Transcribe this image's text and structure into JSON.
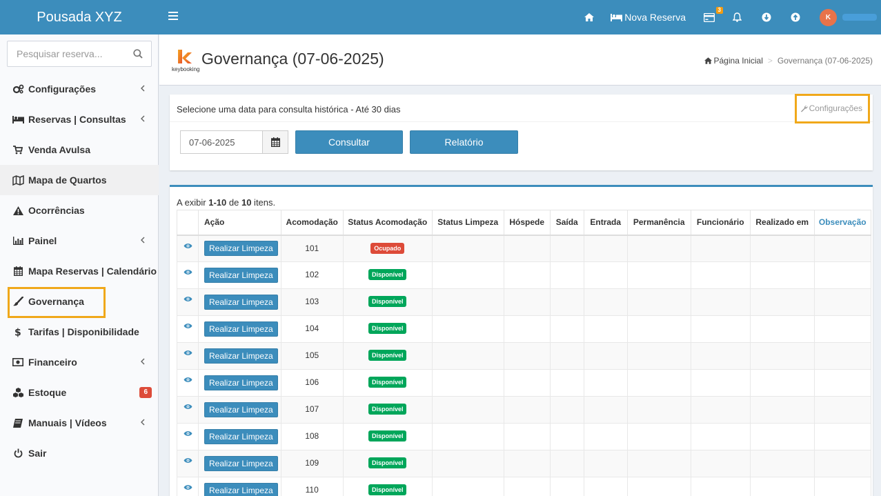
{
  "app": {
    "brand": "Pousada XYZ",
    "nova_reserva": "Nova Reserva",
    "notif_badge": "3",
    "avatar_initial": "K"
  },
  "sidebar": {
    "search_placeholder": "Pesquisar reserva...",
    "items": [
      {
        "label": "Configurações"
      },
      {
        "label": "Reservas | Consultas"
      },
      {
        "label": "Venda Avulsa"
      },
      {
        "label": "Mapa de Quartos"
      },
      {
        "label": "Ocorrências"
      },
      {
        "label": "Painel"
      },
      {
        "label": "Mapa Reservas | Calendário"
      },
      {
        "label": "Governança"
      },
      {
        "label": "Tarifas | Disponibilidade"
      },
      {
        "label": "Financeiro"
      },
      {
        "label": "Estoque",
        "badge": "6"
      },
      {
        "label": "Manuais | Vídeos"
      },
      {
        "label": "Sair"
      }
    ]
  },
  "header": {
    "logo_text": "keybooking",
    "title": "Governança (07-06-2025)",
    "breadcrumb_home": "Página Inicial",
    "breadcrumb_current": "Governança (07-06-2025)"
  },
  "filter": {
    "title": "Selecione uma data para consulta histórica - Até 30 dias",
    "config_link": "Configurações",
    "date_value": "07-06-2025",
    "consultar": "Consultar",
    "relatorio": "Relatório"
  },
  "table": {
    "summary_prefix": "A exibir ",
    "summary_range": "1-10",
    "summary_mid": " de ",
    "summary_total": "10",
    "summary_suffix": " itens.",
    "headers": {
      "acao": "Ação",
      "acomodacao": "Acomodação",
      "status_acomodacao": "Status Acomodação",
      "status_limpeza": "Status Limpeza",
      "hospede": "Hóspede",
      "saida": "Saída",
      "entrada": "Entrada",
      "permanencia": "Permanência",
      "funcionario": "Funcionário",
      "realizado_em": "Realizado em",
      "observacao": "Observação"
    },
    "action_label": "Realizar Limpeza",
    "status_colors": {
      "Ocupado": "#dd4b39",
      "Disponível": "#00a65a"
    },
    "rows": [
      {
        "room": "101",
        "status": "Ocupado"
      },
      {
        "room": "102",
        "status": "Disponível"
      },
      {
        "room": "103",
        "status": "Disponível"
      },
      {
        "room": "104",
        "status": "Disponível"
      },
      {
        "room": "105",
        "status": "Disponível"
      },
      {
        "room": "106",
        "status": "Disponível"
      },
      {
        "room": "107",
        "status": "Disponível"
      },
      {
        "room": "108",
        "status": "Disponível"
      },
      {
        "room": "109",
        "status": "Disponível"
      },
      {
        "room": "110",
        "status": "Disponível"
      }
    ]
  }
}
